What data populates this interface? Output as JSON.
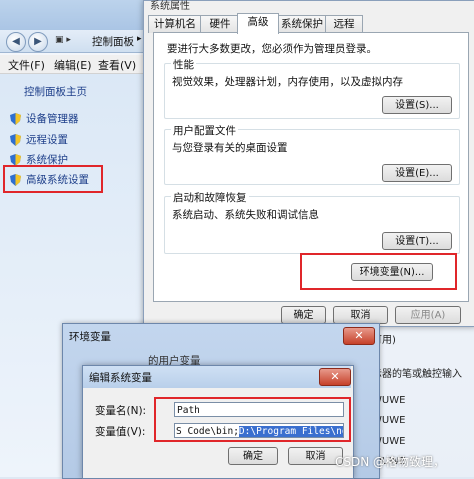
{
  "control_panel": {
    "breadcrumb_root": "控制面板",
    "menu": {
      "file": "文件(F)",
      "edit": "编辑(E)",
      "view": "查看(V)"
    },
    "home_link": "控制面板主页",
    "links": [
      "设备管理器",
      "远程设置",
      "系统保护",
      "高级系统设置"
    ]
  },
  "system_properties": {
    "title": "系统属性",
    "tabs": [
      "计算机名",
      "硬件",
      "高级",
      "系统保护",
      "远程"
    ],
    "active_tab": "高级",
    "intro": "要进行大多数更改，您必须作为管理员登录。",
    "groups": [
      {
        "label": "性能",
        "desc": "视觉效果，处理器计划，内存使用，以及虚拟内存",
        "button": "设置(S)..."
      },
      {
        "label": "用户配置文件",
        "desc": "与您登录有关的桌面设置",
        "button": "设置(E)..."
      },
      {
        "label": "启动和故障恢复",
        "desc": "系统启动、系统失败和调试信息",
        "button": "设置(T)..."
      }
    ],
    "env_button": "环境变量(N)...",
    "ok": "确定",
    "cancel": "取消",
    "apply": "应用(A)"
  },
  "env_window": {
    "title": "环境变量",
    "partial_text": "的用户变量",
    "right_column": [
      "可用)",
      "示器的笔或触控输入",
      "WUWE",
      "WUWE",
      "WUWE",
      "WUWE"
    ]
  },
  "edit_dialog": {
    "title": "编辑系统变量",
    "name_label": "变量名(N):",
    "value_label": "变量值(V):",
    "name_value": "Path",
    "value_unselected": "S Code\\bin;",
    "value_selected": "D:\\Program Files\\nodejs\\",
    "ok": "确定",
    "cancel": "取消"
  },
  "watermark": "CSDN @格物致理，",
  "colors": {
    "highlight_box": "#e0262a",
    "link": "#1e3f8a",
    "selection": "#3a6fcf"
  },
  "icons": [
    "back-arrow-icon",
    "forward-arrow-icon",
    "shield-icon",
    "close-icon"
  ]
}
